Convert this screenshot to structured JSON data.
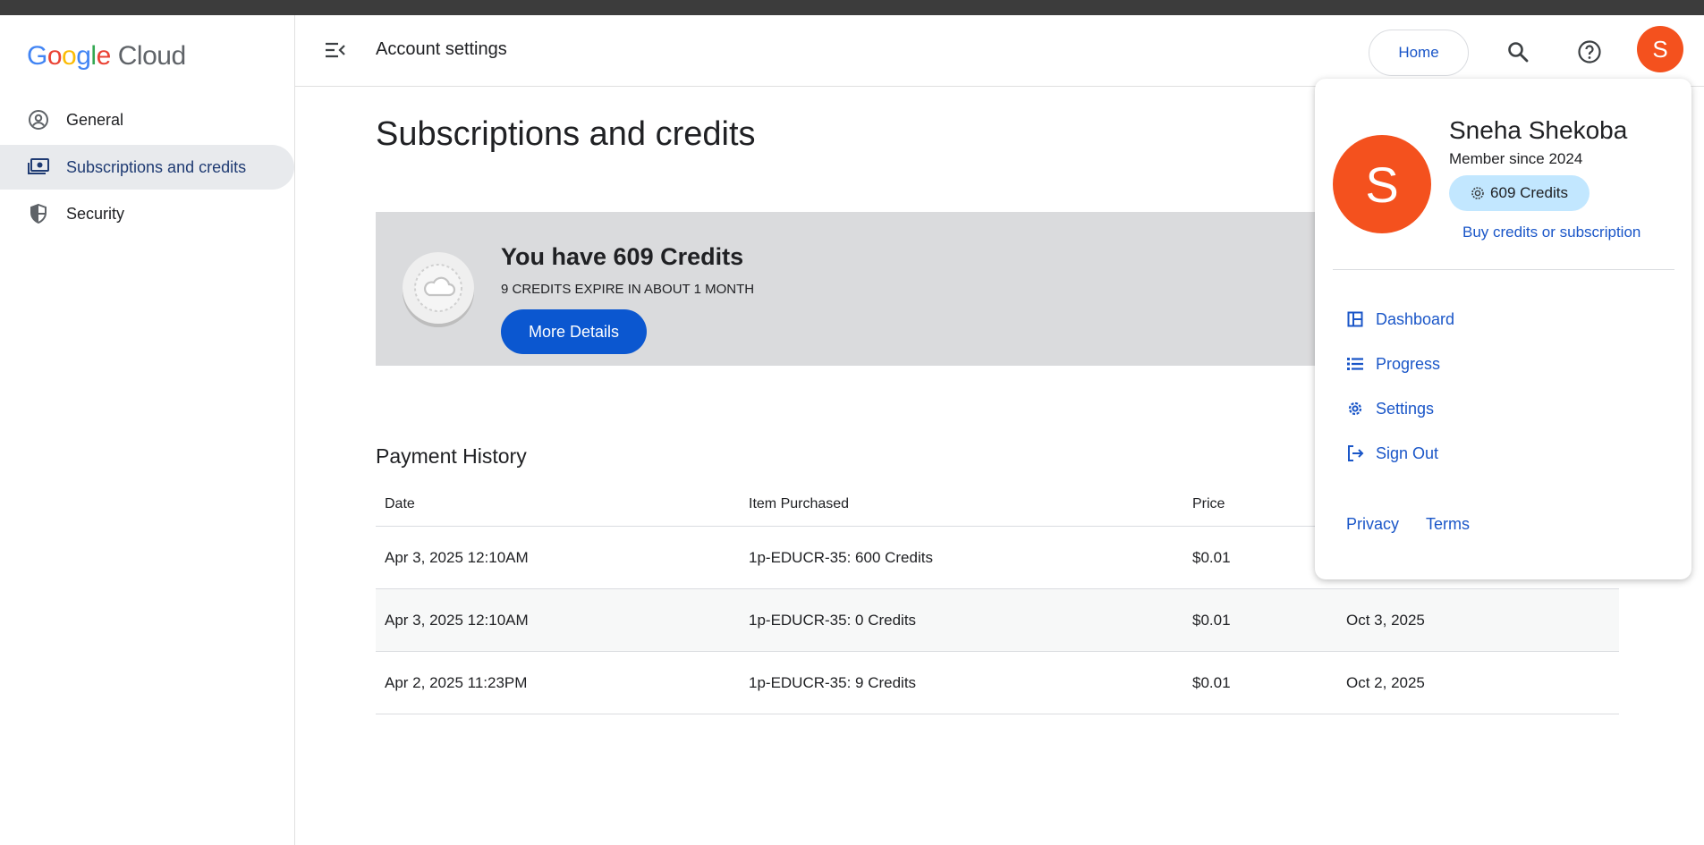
{
  "sidebar": {
    "logo": {
      "letters": [
        "G",
        "o",
        "o",
        "g",
        "l",
        "e"
      ],
      "suffix": "Cloud"
    },
    "items": [
      {
        "label": "General",
        "icon": "account-circle-icon"
      },
      {
        "label": "Subscriptions and credits",
        "icon": "payments-icon",
        "active": true
      },
      {
        "label": "Security",
        "icon": "shield-icon"
      }
    ]
  },
  "header": {
    "title": "Account settings",
    "home_label": "Home",
    "avatar_initial": "S"
  },
  "main": {
    "page_title": "Subscriptions and credits",
    "credits_card": {
      "headline": "You have 609 Credits",
      "expiry": "9 CREDITS EXPIRE IN ABOUT 1 MONTH",
      "button_label": "More Details"
    },
    "payment_history": {
      "title": "Payment History",
      "columns": [
        "Date",
        "Item Purchased",
        "Price",
        ""
      ],
      "rows": [
        [
          "Apr 3, 2025 12:10AM",
          "1p-EDUCR-35: 600 Credits",
          "$0.01",
          ""
        ],
        [
          "Apr 3, 2025 12:10AM",
          "1p-EDUCR-35: 0 Credits",
          "$0.01",
          "Oct 3, 2025"
        ],
        [
          "Apr 2, 2025 11:23PM",
          "1p-EDUCR-35: 9 Credits",
          "$0.01",
          "Oct 2, 2025"
        ]
      ]
    }
  },
  "popup": {
    "avatar_initial": "S",
    "user_name": "Sneha Shekoba",
    "member_since": "Member since 2024",
    "credits_chip": "609 Credits",
    "buy_link": "Buy credits or subscription",
    "menu": [
      {
        "label": "Dashboard",
        "icon": "dashboard-icon"
      },
      {
        "label": "Progress",
        "icon": "list-icon"
      },
      {
        "label": "Settings",
        "icon": "gear-icon"
      },
      {
        "label": "Sign Out",
        "icon": "logout-icon"
      }
    ],
    "footer": {
      "privacy": "Privacy",
      "terms": "Terms"
    }
  },
  "colors": {
    "accent_blue": "#0b57d0",
    "link_blue": "#1a56c8",
    "avatar_orange": "#f4511e",
    "chip_blue": "#c2e7ff",
    "card_gray": "#dadbdd"
  }
}
